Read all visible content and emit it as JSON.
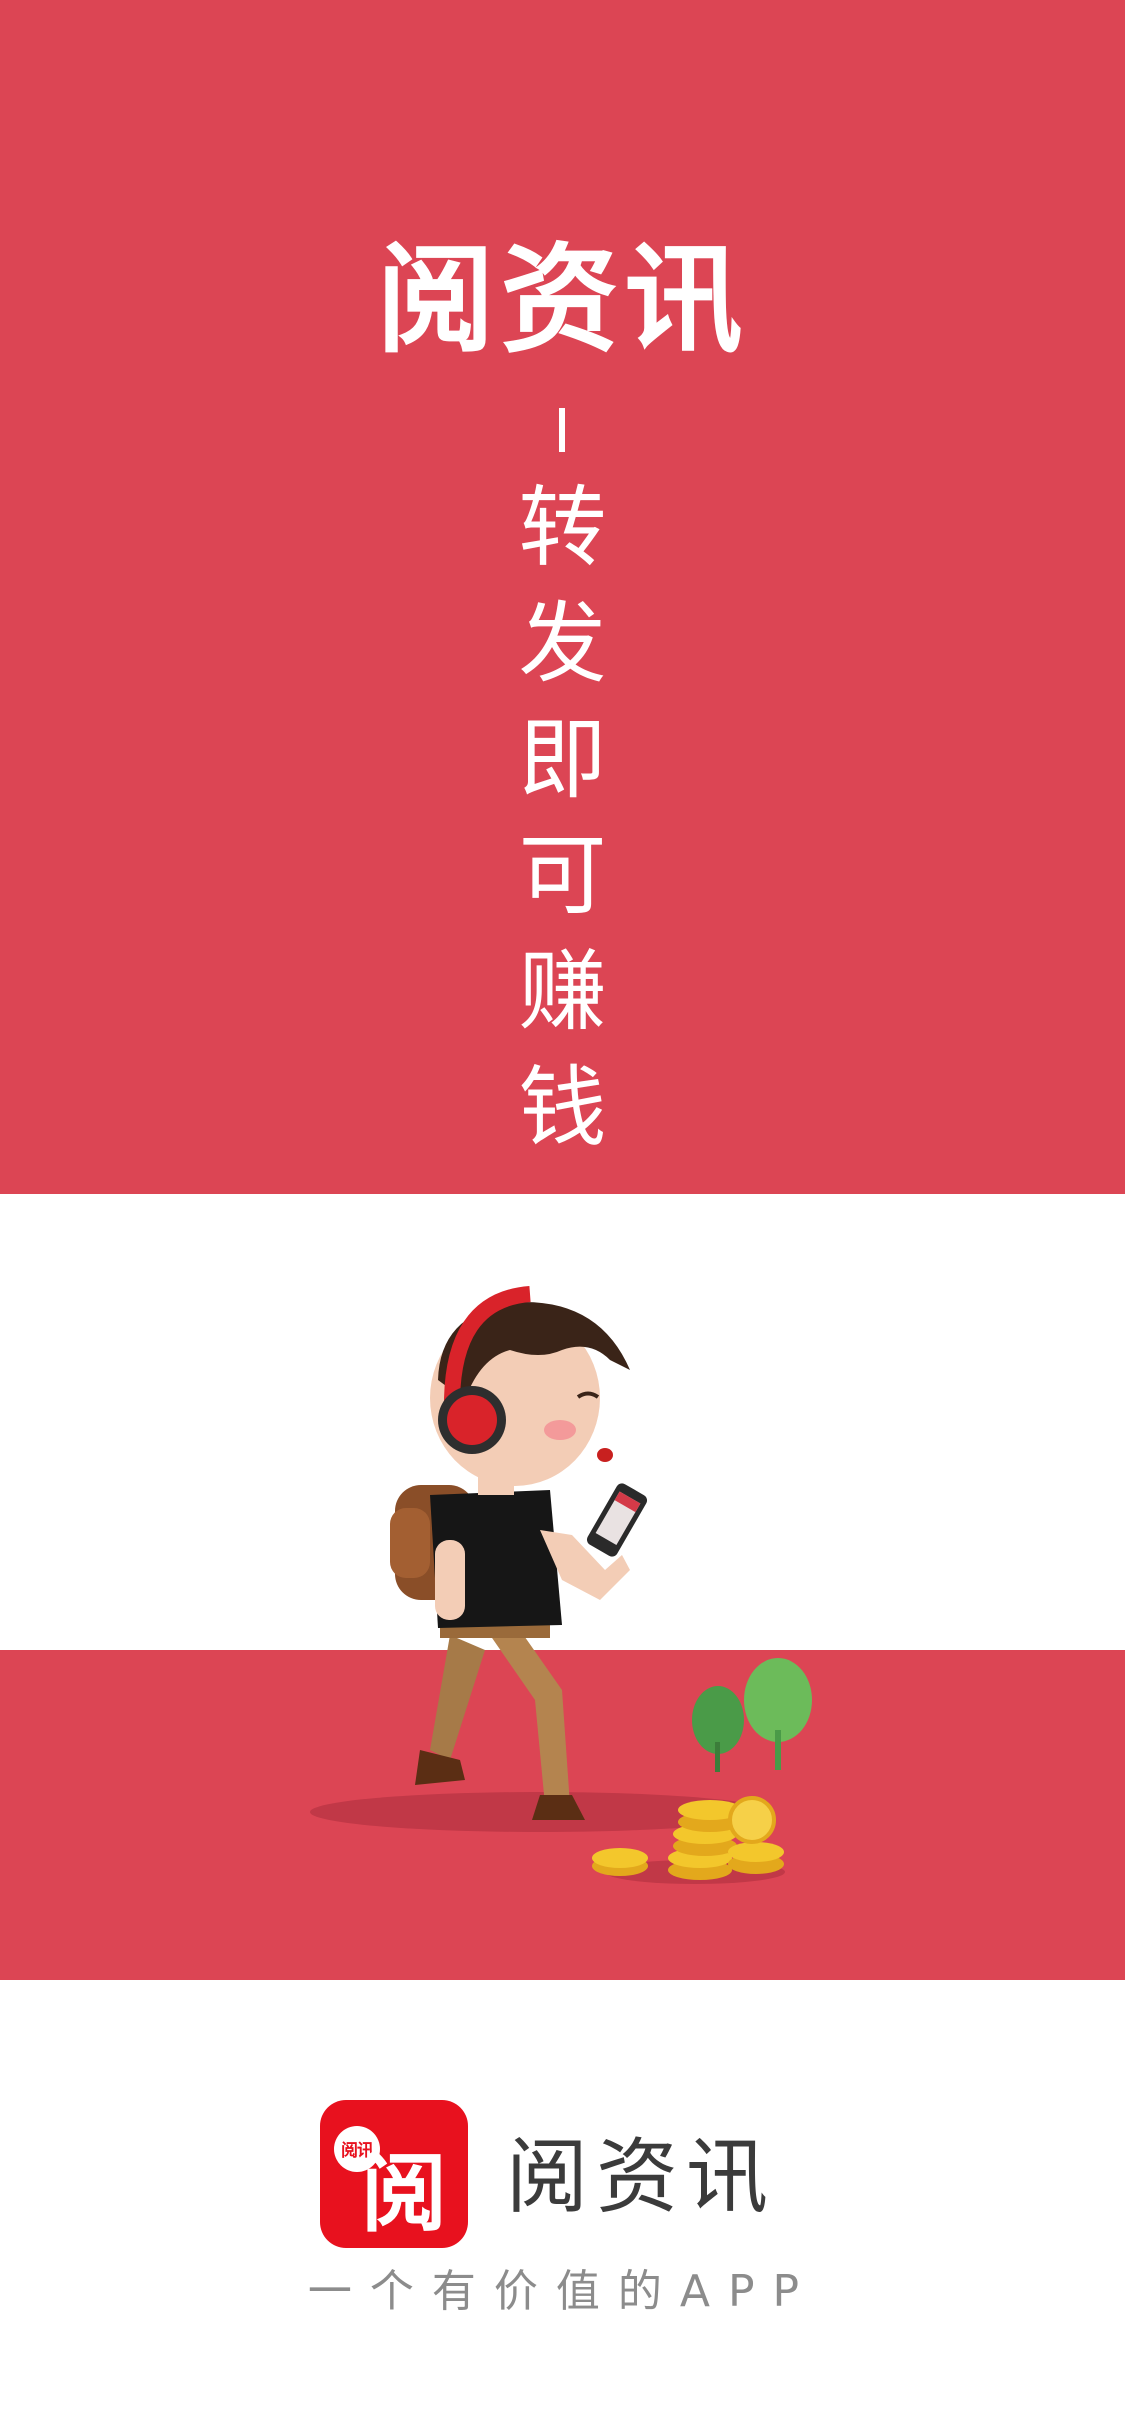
{
  "hero": {
    "title": "阅资讯",
    "slogan": [
      "转",
      "发",
      "即",
      "可",
      "赚",
      "钱"
    ],
    "background_color": "#dc4554"
  },
  "illustration": {
    "icon": "walking-man-phone-headphones-coins-illustration"
  },
  "brand": {
    "app_icon_badge": "阅讯",
    "app_icon_glyph": "阅",
    "app_name": "阅资讯",
    "tagline": "一个有价值的APP",
    "icon_color": "#e8111e"
  }
}
